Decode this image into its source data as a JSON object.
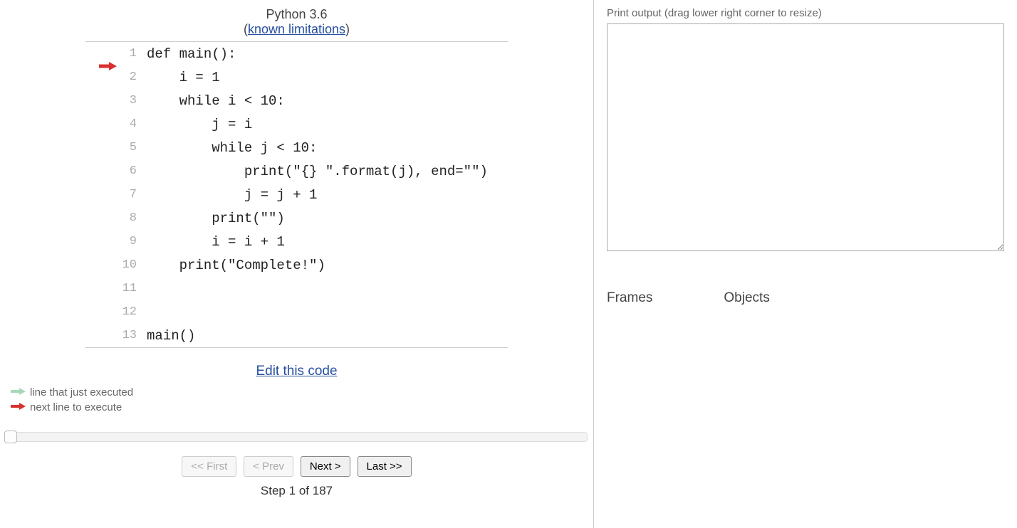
{
  "header": {
    "language": "Python 3.6",
    "limitations_text": "known limitations"
  },
  "code": {
    "current_line": 1,
    "lines": [
      "def main():",
      "    i = 1",
      "    while i < 10:",
      "        j = i",
      "        while j < 10:",
      "            print(\"{} \".format(j), end=\"\")",
      "            j = j + 1",
      "        print(\"\")",
      "        i = i + 1",
      "    print(\"Complete!\")",
      "",
      "",
      "main()"
    ]
  },
  "edit_link": "Edit this code",
  "legend": {
    "just_executed": "line that just executed",
    "next_line": "next line to execute"
  },
  "controls": {
    "first": "<< First",
    "prev": "< Prev",
    "next": "Next >",
    "last": "Last >>",
    "first_disabled": true,
    "prev_disabled": true,
    "next_disabled": false,
    "last_disabled": false
  },
  "step": {
    "current": 1,
    "total": 187,
    "label_prefix": "Step",
    "label_middle": "of"
  },
  "output": {
    "label": "Print output (drag lower right corner to resize)",
    "content": ""
  },
  "panels": {
    "frames": "Frames",
    "objects": "Objects"
  }
}
